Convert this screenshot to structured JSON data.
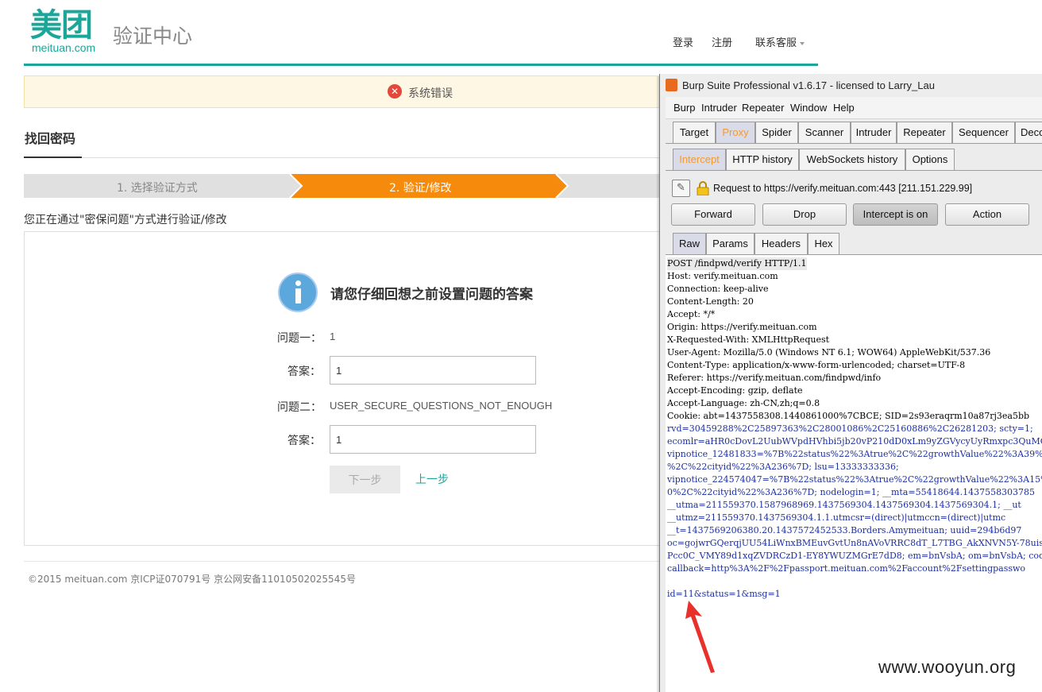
{
  "logo": {
    "cn": "美团",
    "en": "meituan.com",
    "subtitle": "验证中心"
  },
  "topnav": {
    "login": "登录",
    "register": "注册",
    "support": "联系客服"
  },
  "error_bar": {
    "icon": "error-circle-icon",
    "text": "系统错误"
  },
  "section": {
    "title": "找回密码"
  },
  "steps": [
    {
      "label": "1. 选择验证方式",
      "state": "done"
    },
    {
      "label": "2. 验证/修改",
      "state": "active"
    },
    {
      "label": "",
      "state": "pending"
    }
  ],
  "intro": "您正在通过\"密保问题\"方式进行验证/修改",
  "form": {
    "title": "请您仔细回想之前设置问题的答案",
    "q1_label": "问题一：",
    "q1_value": "1",
    "a1_label": "答案：",
    "a1_value": "1",
    "q2_label": "问题二：",
    "q2_value": "USER_SECURE_QUESTIONS_NOT_ENOUGH",
    "a2_label": "答案：",
    "a2_value": "1",
    "next": "下一步",
    "prev": "上一步"
  },
  "footer": "©2015 meituan.com 京ICP证070791号 京公网安备11010502025545号",
  "colors": {
    "brand": "#1aa699",
    "step_active": "#f58a0c",
    "step_inactive": "#e0e0e0",
    "burp_accent": "#f29a32"
  },
  "burp": {
    "title": "Burp Suite Professional v1.6.17 - licensed to Larry_Lau",
    "menu": [
      "Burp",
      "Intruder",
      "Repeater",
      "Window",
      "Help"
    ],
    "main_tabs": [
      "Target",
      "Proxy",
      "Spider",
      "Scanner",
      "Intruder",
      "Repeater",
      "Sequencer",
      "Deco"
    ],
    "sub_tabs": [
      "Intercept",
      "HTTP history",
      "WebSockets history",
      "Options"
    ],
    "request_to": "Request to https://verify.meituan.com:443  [211.151.229.99]",
    "buttons": {
      "forward": "Forward",
      "drop": "Drop",
      "intercept": "Intercept is on",
      "action": "Action"
    },
    "raw_tabs": [
      "Raw",
      "Params",
      "Headers",
      "Hex"
    ],
    "raw_lines": [
      {
        "text": "POST /findpwd/verify HTTP/1.1",
        "color": "#000000"
      },
      {
        "text": "Host: verify.meituan.com",
        "color": "#000000"
      },
      {
        "text": "Connection: keep-alive",
        "color": "#000000"
      },
      {
        "text": "Content-Length: 20",
        "color": "#000000"
      },
      {
        "text": "Accept: */*",
        "color": "#000000"
      },
      {
        "text": "Origin: https://verify.meituan.com",
        "color": "#000000"
      },
      {
        "text": "X-Requested-With: XMLHttpRequest",
        "color": "#000000"
      },
      {
        "text": "User-Agent: Mozilla/5.0 (Windows NT 6.1; WOW64) AppleWebKit/537.36",
        "color": "#000000"
      },
      {
        "text": "Content-Type: application/x-www-form-urlencoded; charset=UTF-8",
        "color": "#000000"
      },
      {
        "text": "Referer: https://verify.meituan.com/findpwd/info",
        "color": "#000000"
      },
      {
        "text": "Accept-Encoding: gzip, deflate",
        "color": "#000000"
      },
      {
        "text": "Accept-Language: zh-CN,zh;q=0.8",
        "color": "#000000"
      },
      {
        "text": "Cookie: abt=1437558308.1440861000%7CBCE; SID=2s93eraqrm10a87rj3ea5bb",
        "color": "#000000"
      },
      {
        "text": "rvd=30459288%2C25897363%2C28001086%2C25160886%2C26281203; scty=1;",
        "color": "#1c2fa3"
      },
      {
        "text": "ecomlr=aHR0cDovL2UubWVpdHVhbi5jb20vP210dD0xLm9yZGVycyUyRmxpc3QuMC4wL",
        "color": "#1c2fa3"
      },
      {
        "text": "vipnotice_12481833=%7B%22status%22%3Atrue%2C%22growthValue%22%3A39%2",
        "color": "#1c2fa3"
      },
      {
        "text": "%2C%22cityid%22%3A236%7D; lsu=13333333336;",
        "color": "#1c2fa3"
      },
      {
        "text": "vipnotice_224574047=%7B%22status%22%3Atrue%2C%22growthValue%22%3A15%",
        "color": "#1c2fa3"
      },
      {
        "text": "0%2C%22cityid%22%3A236%7D; nodelogin=1; __mta=55418644.1437558303785",
        "color": "#1c2fa3"
      },
      {
        "text": "__utma=211559370.1587968969.1437569304.1437569304.1437569304.1; __ut",
        "color": "#1c2fa3"
      },
      {
        "text": "__utmz=211559370.1437569304.1.1.utmcsr=(direct)|utmccn=(direct)|utmc",
        "color": "#1c2fa3"
      },
      {
        "text": "__t=1437569206380.20.1437572452533.Borders.Amymeituan; uuid=294b6d97",
        "color": "#1c2fa3"
      },
      {
        "text": "oc=gojwrGQerqjUU54LiWnxBMEuvGvtUn8nAVoVRRC8dT_L7TBG_AkXNVN5Y-78uisVE",
        "color": "#1c2fa3"
      },
      {
        "text": "Pcc0C_VMY89d1xqZVDRCzD1-EY8YWUZMGrE7dD8; em=bnVsbA; om=bnVsbA; code=",
        "color": "#1c2fa3"
      },
      {
        "text": "callback=http%3A%2F%2Fpassport.meituan.com%2Faccount%2Fsettingpasswo",
        "color": "#1c2fa3"
      },
      {
        "text": "",
        "color": "#000000"
      },
      {
        "text": "id=11&status=1&msg=1",
        "color": "#1c2fa3"
      }
    ]
  },
  "watermark": "www.wooyun.org"
}
